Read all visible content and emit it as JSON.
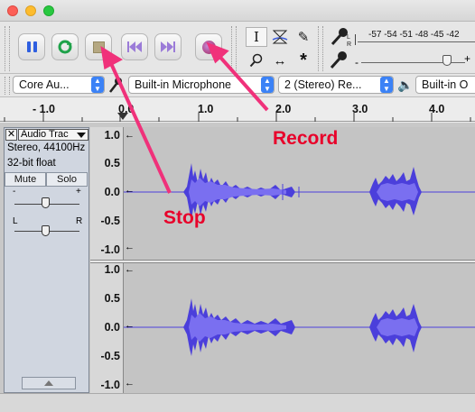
{
  "colors": {
    "accent": "#3b82f6",
    "annotation": "#e8002a",
    "waveform": "#4b3fdb",
    "waveform_rms": "#7a6ff0"
  },
  "transport": {
    "pause": "pause-icon",
    "play": "loop-play-icon",
    "stop": "stop-icon",
    "skip_start": "skip-to-start-icon",
    "skip_end": "skip-to-end-icon",
    "record": "record-icon"
  },
  "meter": {
    "scale": "-57 -54 -51 -48 -45 -42"
  },
  "devices": {
    "host": "Core Au...",
    "input": "Built-in Microphone",
    "channels": "2 (Stereo) Re...",
    "output": "Built-in O"
  },
  "ruler": {
    "labels": [
      "- 1.0",
      "0.0",
      "1.0",
      "2.0",
      "3.0",
      "4.0"
    ]
  },
  "track": {
    "name": "Audio Trac",
    "format": "Stereo, 44100Hz",
    "bit_depth": "32-bit float",
    "mute": "Mute",
    "solo": "Solo",
    "pan_left": "L",
    "pan_right": "R",
    "gain_minus": "-",
    "gain_plus": "+"
  },
  "vertical_scale": {
    "top": [
      "1.0",
      "0.5",
      "0.0",
      "-0.5",
      "-1.0"
    ],
    "bottom": [
      "1.0",
      "0.5",
      "0.0",
      "-0.5",
      "-1.0"
    ]
  },
  "annotations": {
    "record": "Record",
    "stop": "Stop"
  }
}
